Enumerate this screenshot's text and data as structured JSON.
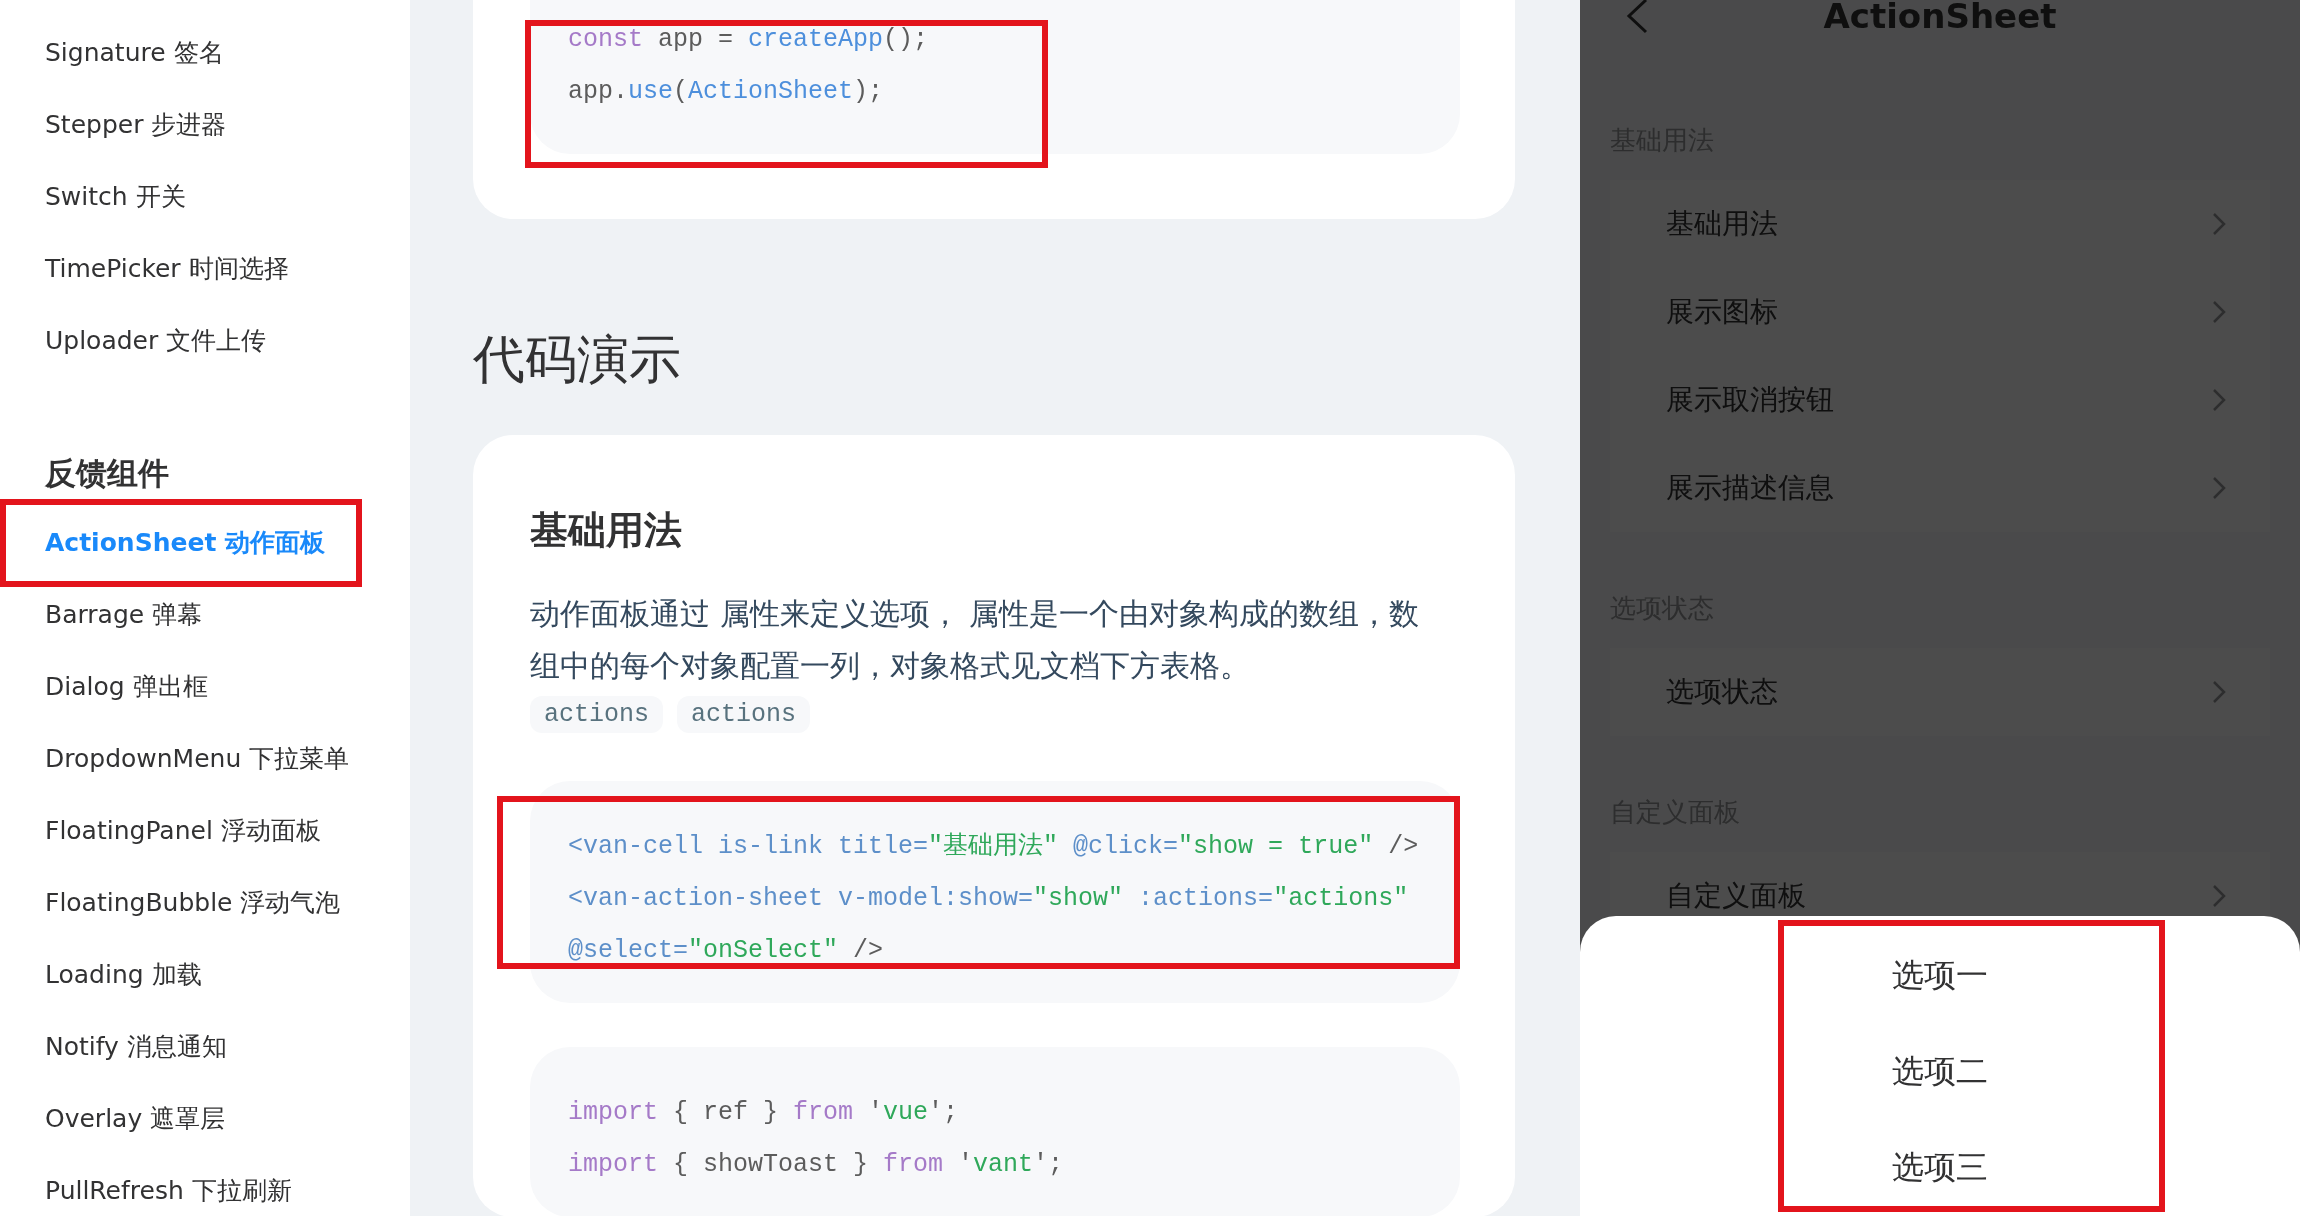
{
  "sidebar": {
    "items": [
      {
        "label": "Signature 签名",
        "selected": false
      },
      {
        "label": "Stepper 步进器",
        "selected": false
      },
      {
        "label": "Switch 开关",
        "selected": false
      },
      {
        "label": "TimePicker 时间选择",
        "selected": false
      },
      {
        "label": "Uploader 文件上传",
        "selected": false
      }
    ],
    "group": {
      "title": "反馈组件",
      "items": [
        {
          "label": "ActionSheet 动作面板",
          "selected": true
        },
        {
          "label": "Barrage 弹幕",
          "selected": false
        },
        {
          "label": "Dialog 弹出框",
          "selected": false
        },
        {
          "label": "DropdownMenu 下拉菜单",
          "selected": false
        },
        {
          "label": "FloatingPanel 浮动面板",
          "selected": false
        },
        {
          "label": "FloatingBubble 浮动气泡",
          "selected": false
        },
        {
          "label": "Loading 加载",
          "selected": false
        },
        {
          "label": "Notify 消息通知",
          "selected": false
        },
        {
          "label": "Overlay 遮罩层",
          "selected": false
        },
        {
          "label": "PullRefresh 下拉刷新",
          "selected": false
        }
      ]
    }
  },
  "main": {
    "top_code": {
      "highlighted": true,
      "lines": [
        [
          {
            "kind": "keyword",
            "text": "const"
          },
          {
            "kind": "plain",
            "text": " app = "
          },
          {
            "kind": "function",
            "text": "createApp"
          },
          {
            "kind": "plain",
            "text": "();"
          }
        ],
        [
          {
            "kind": "plain",
            "text": "app."
          },
          {
            "kind": "function",
            "text": "use"
          },
          {
            "kind": "plain",
            "text": "("
          },
          {
            "kind": "function",
            "text": "ActionSheet"
          },
          {
            "kind": "plain",
            "text": ");"
          }
        ]
      ]
    },
    "heading": "代码演示",
    "section": {
      "title": "基础用法",
      "description": "动作面板通过 属性来定义选项， 属性是一个由对象构成的数组，数组中的每个对象配置一列，对象格式见文档下方表格。",
      "inline_codes": [
        "actions",
        "actions"
      ],
      "code_blocks": [
        {
          "highlighted": true,
          "lines": [
            [
              {
                "kind": "tag",
                "text": "<van-cell is-link title="
              },
              {
                "kind": "string",
                "text": "\"基础用法\""
              },
              {
                "kind": "tag",
                "text": " @click="
              },
              {
                "kind": "string",
                "text": "\"show = true\""
              },
              {
                "kind": "plain",
                "text": " />"
              }
            ],
            [
              {
                "kind": "tag",
                "text": "<van-action-sheet v-model:show="
              },
              {
                "kind": "string",
                "text": "\"show\""
              },
              {
                "kind": "tag",
                "text": " :actions="
              },
              {
                "kind": "string",
                "text": "\"actions\""
              }
            ],
            [
              {
                "kind": "tag",
                "text": "@select="
              },
              {
                "kind": "string",
                "text": "\"onSelect\""
              },
              {
                "kind": "plain",
                "text": " />"
              }
            ]
          ]
        },
        {
          "highlighted": false,
          "lines": [
            [
              {
                "kind": "keyword",
                "text": "import"
              },
              {
                "kind": "plain",
                "text": " { ref } "
              },
              {
                "kind": "keyword",
                "text": "from"
              },
              {
                "kind": "plain",
                "text": " '"
              },
              {
                "kind": "string",
                "text": "vue"
              },
              {
                "kind": "plain",
                "text": "';"
              }
            ],
            [
              {
                "kind": "keyword",
                "text": "import"
              },
              {
                "kind": "plain",
                "text": " { showToast } "
              },
              {
                "kind": "keyword",
                "text": "from"
              },
              {
                "kind": "plain",
                "text": " '"
              },
              {
                "kind": "string",
                "text": "vant"
              },
              {
                "kind": "plain",
                "text": "';"
              }
            ]
          ]
        }
      ]
    }
  },
  "phone": {
    "title": "ActionSheet",
    "dimmed": true,
    "groups": [
      {
        "title": "基础用法",
        "cells": [
          "基础用法",
          "展示图标",
          "展示取消按钮",
          "展示描述信息"
        ]
      },
      {
        "title": "选项状态",
        "cells": [
          "选项状态"
        ]
      },
      {
        "title": "自定义面板",
        "cells": [
          "自定义面板"
        ]
      }
    ],
    "sheet": {
      "highlighted": true,
      "options": [
        "选项一",
        "选项二",
        "选项三"
      ]
    }
  }
}
